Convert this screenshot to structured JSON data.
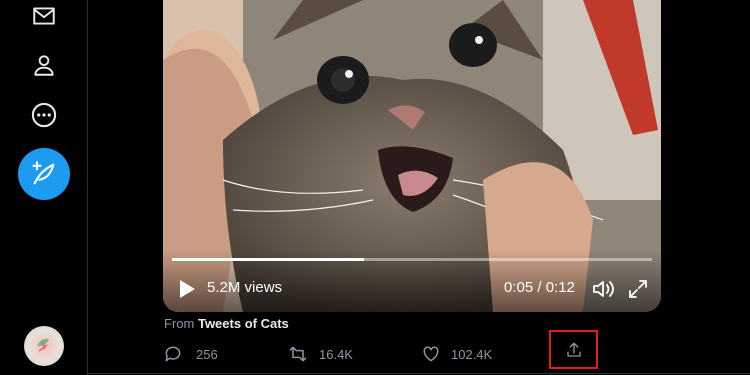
{
  "sidebar": {
    "icons": [
      "messages-icon",
      "profile-icon",
      "more-icon",
      "compose-tweet-icon",
      "avatar"
    ]
  },
  "video": {
    "views": "5.2M views",
    "time": "0:05 / 0:12",
    "progress": 0.4
  },
  "tweet": {
    "from_prefix": "From",
    "source": "Tweets of Cats",
    "replies": "256",
    "retweets": "16.4K",
    "likes": "102.4K"
  },
  "colors": {
    "accent": "#1d9bf0",
    "highlight": "#e21b1b",
    "muted": "#8b98a5"
  }
}
